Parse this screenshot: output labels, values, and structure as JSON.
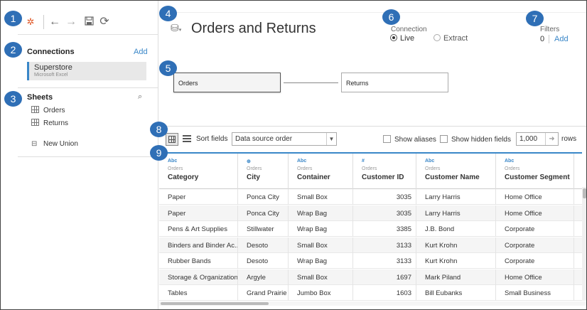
{
  "callouts": [
    "1",
    "2",
    "3",
    "4",
    "5",
    "6",
    "7",
    "8",
    "9"
  ],
  "toolbar": {
    "logo_icon": "tableau-logo-icon",
    "back_icon": "←",
    "forward_icon": "→",
    "save_icon": "save-icon",
    "refresh_icon": "⟳"
  },
  "connections": {
    "title": "Connections",
    "add_label": "Add",
    "items": [
      {
        "name": "Superstore",
        "type": "Microsoft Excel"
      }
    ]
  },
  "sheets": {
    "title": "Sheets",
    "search_icon": "⌕",
    "items": [
      {
        "label": "Orders"
      },
      {
        "label": "Returns"
      }
    ],
    "new_union_label": "New Union"
  },
  "datasource": {
    "title": "Orders and Returns",
    "connection_label": "Connection",
    "options": [
      {
        "label": "Live",
        "selected": true
      },
      {
        "label": "Extract",
        "selected": false
      }
    ],
    "filters_label": "Filters",
    "filters_count": "0",
    "filters_add": "Add"
  },
  "canvas": {
    "tables": [
      "Orders",
      "Returns"
    ]
  },
  "grid_toolbar": {
    "sort_label": "Sort fields",
    "sort_value": "Data source order",
    "show_aliases": "Show aliases",
    "show_hidden": "Show hidden fields",
    "rows_value": "1,000",
    "rows_label": "rows"
  },
  "grid": {
    "columns": [
      {
        "type": "Abc",
        "source": "Orders",
        "name": "Category"
      },
      {
        "type": "⊕",
        "source": "Orders",
        "name": "City"
      },
      {
        "type": "Abc",
        "source": "Orders",
        "name": "Container"
      },
      {
        "type": "#",
        "source": "Orders",
        "name": "Customer ID"
      },
      {
        "type": "Abc",
        "source": "Orders",
        "name": "Customer Name"
      },
      {
        "type": "Abc",
        "source": "Orders",
        "name": "Customer Segment"
      }
    ],
    "rows": [
      [
        "Paper",
        "Ponca City",
        "Small Box",
        "3035",
        "Larry Harris",
        "Home Office"
      ],
      [
        "Paper",
        "Ponca City",
        "Wrap Bag",
        "3035",
        "Larry Harris",
        "Home Office"
      ],
      [
        "Pens & Art Supplies",
        "Stillwater",
        "Wrap Bag",
        "3385",
        "J.B. Bond",
        "Corporate"
      ],
      [
        "Binders and Binder Ac...",
        "Desoto",
        "Small Box",
        "3133",
        "Kurt Krohn",
        "Corporate"
      ],
      [
        "Rubber Bands",
        "Desoto",
        "Wrap Bag",
        "3133",
        "Kurt Krohn",
        "Corporate"
      ],
      [
        "Storage & Organization",
        "Argyle",
        "Small Box",
        "1697",
        "Mark Piland",
        "Home Office"
      ],
      [
        "Tables",
        "Grand Prairie",
        "Jumbo Box",
        "1603",
        "Bill Eubanks",
        "Small Business"
      ]
    ]
  },
  "colors": {
    "accent": "#3a87c8",
    "callout": "#2f6fb6"
  }
}
